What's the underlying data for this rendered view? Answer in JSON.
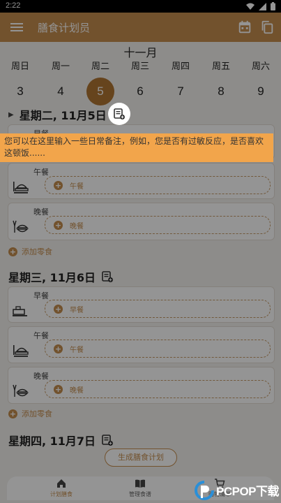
{
  "status_bar": {
    "time": "2:22"
  },
  "app_bar": {
    "title": "膳食计划员"
  },
  "week": {
    "month": "十一月",
    "days": [
      {
        "name": "周日",
        "num": "3"
      },
      {
        "name": "周一",
        "num": "4"
      },
      {
        "name": "周二",
        "num": "5",
        "selected": true
      },
      {
        "name": "周三",
        "num": "6"
      },
      {
        "name": "周四",
        "num": "7"
      },
      {
        "name": "周五",
        "num": "8"
      },
      {
        "name": "周六",
        "num": "9"
      }
    ]
  },
  "days": [
    {
      "date": "星期二, 11月5日",
      "meals": [
        {
          "label": "早餐",
          "add_text": "早餐"
        },
        {
          "label": "午餐",
          "add_text": "午餐"
        },
        {
          "label": "晚餐",
          "add_text": "晚餐"
        }
      ],
      "snack": "添加零食"
    },
    {
      "date": "星期三, 11月6日",
      "meals": [
        {
          "label": "早餐",
          "add_text": "早餐"
        },
        {
          "label": "午餐",
          "add_text": "午餐"
        },
        {
          "label": "晚餐",
          "add_text": "晚餐"
        }
      ],
      "snack": "添加零食"
    },
    {
      "date": "星期四, 11月7日"
    }
  ],
  "generate_button": "生成膳食计划",
  "bottom_nav": [
    {
      "label": "计划膳食",
      "icon": "home-icon",
      "active": true
    },
    {
      "label": "管理食谱",
      "icon": "book-icon"
    },
    {
      "label": "购物清单",
      "icon": "cart-icon"
    }
  ],
  "tooltip": "您可以在这里输入一些日常备注，例如，您是否有过敏反应，是否喜欢这顿饭......",
  "watermark": "PCPOP下载",
  "colors": {
    "accent": "#c58e4f",
    "selected": "#b07533",
    "tooltip": "#f2a54b"
  }
}
